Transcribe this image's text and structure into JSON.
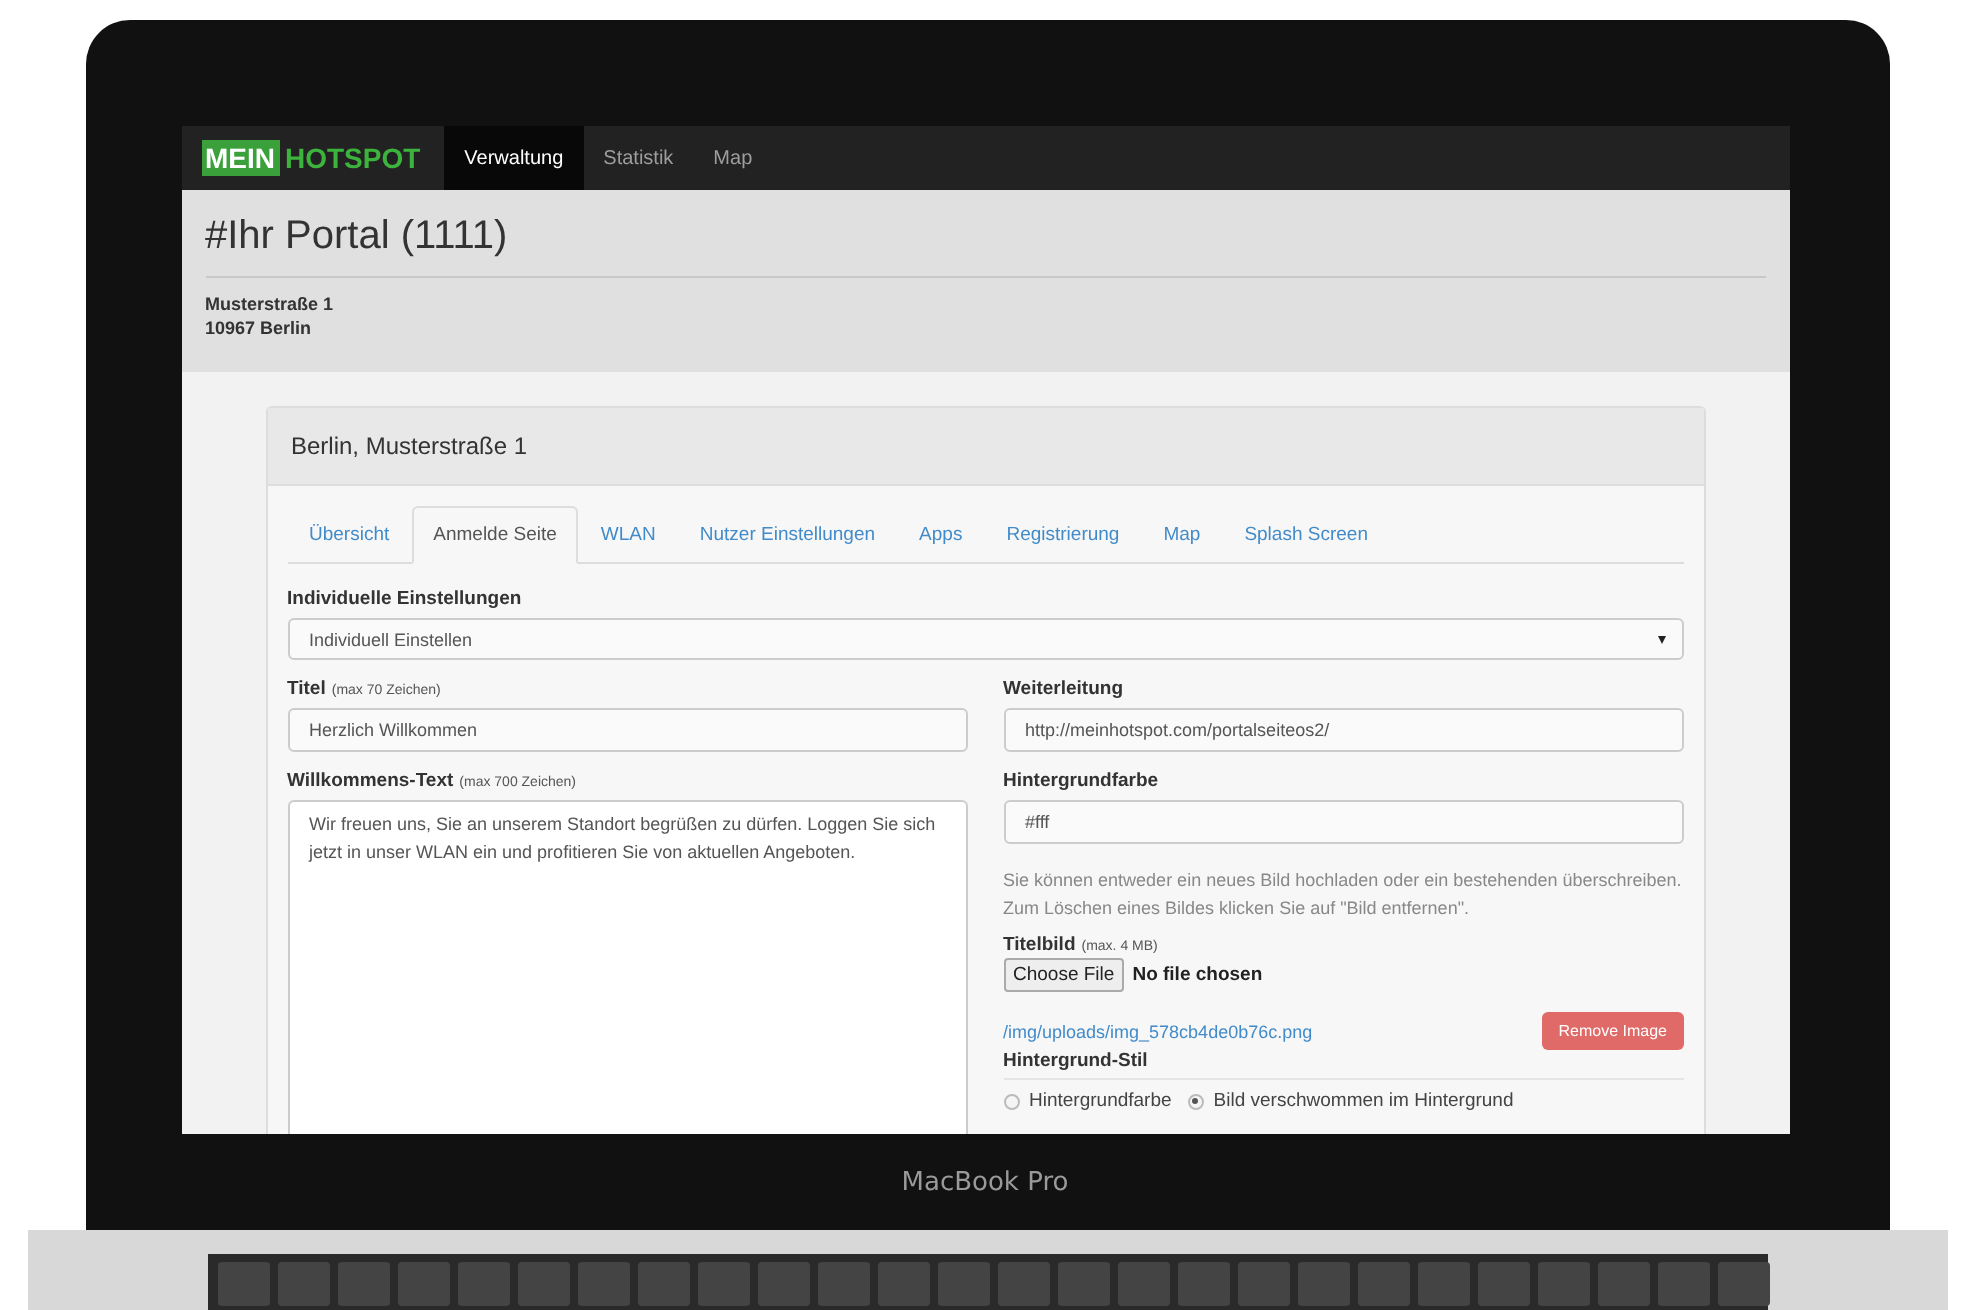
{
  "navbar": {
    "brand": {
      "first": "MEIN",
      "second": "HOTSPOT"
    },
    "items": [
      {
        "label": "Verwaltung",
        "selected": true
      },
      {
        "label": "Statistik",
        "selected": false
      },
      {
        "label": "Map",
        "selected": false
      }
    ]
  },
  "header": {
    "title": "#Ihr Portal (1111)",
    "address": [
      "Musterstraße 1",
      "10967 Berlin"
    ]
  },
  "panel": {
    "title": "Berlin, Musterstraße 1",
    "tabs": [
      {
        "label": "Übersicht",
        "selected": false
      },
      {
        "label": "Anmelde Seite",
        "selected": true
      },
      {
        "label": "WLAN",
        "selected": false
      },
      {
        "label": "Nutzer Einstellungen",
        "selected": false
      },
      {
        "label": "Apps",
        "selected": false
      },
      {
        "label": "Registrierung",
        "selected": false
      },
      {
        "label": "Map",
        "selected": false
      },
      {
        "label": "Splash Screen",
        "selected": false
      }
    ],
    "settings": {
      "label": "Individuelle Einstellungen",
      "value": "Individuell Einstellen"
    },
    "left": {
      "title": {
        "label": "Titel",
        "hint": "(max 70 Zeichen)",
        "value": "Herzlich Willkommen"
      },
      "welcome": {
        "label": "Willkommens-Text",
        "hint": "(max 700 Zeichen)",
        "value": "Wir freuen uns, Sie an unserem Standort begrüßen zu dürfen. Loggen Sie sich jetzt in unser WLAN ein und profitieren Sie von aktuellen Angeboten."
      }
    },
    "right": {
      "redirect": {
        "label": "Weiterleitung",
        "value": "http://meinhotspot.com/portalseiteos2/"
      },
      "background_color": {
        "label": "Hintergrundfarbe",
        "value": "#fff"
      },
      "help": "Sie können entweder ein neues Bild hochladen oder ein bestehenden überschreiben. Zum Löschen eines Bildes klicken Sie auf \"Bild entfernen\".",
      "title_image": {
        "label": "Titelbild",
        "hint": "(max. 4 MB)",
        "button": "Choose File",
        "status": "No file chosen"
      },
      "image_link": "/img/uploads/img_578cb4de0b76c.png",
      "remove_button": "Remove Image",
      "background_style": {
        "label": "Hintergrund-Stil",
        "options": [
          {
            "label": "Hintergrundfarbe",
            "selected": false
          },
          {
            "label": "Bild verschwommen im Hintergrund",
            "selected": true
          }
        ]
      }
    }
  },
  "device_label": "MacBook Pro"
}
